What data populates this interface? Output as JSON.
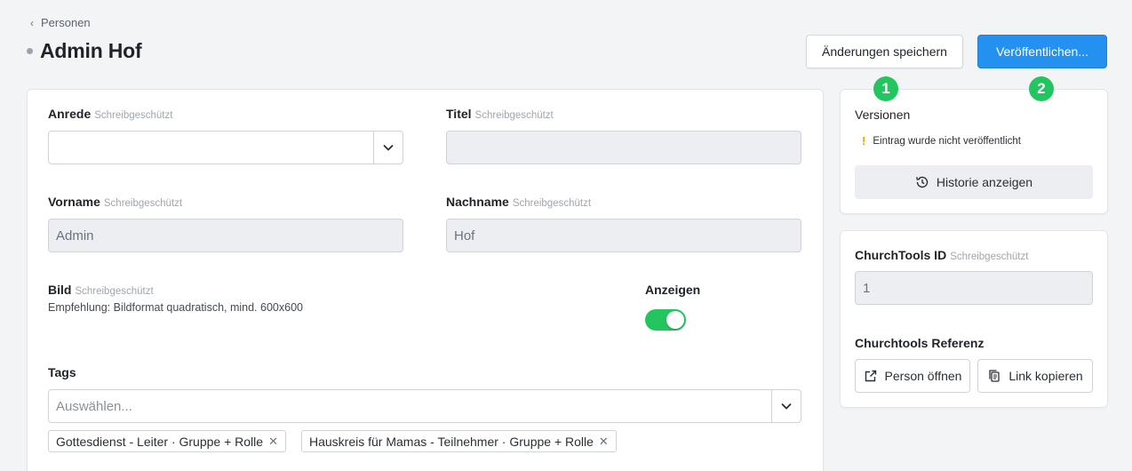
{
  "breadcrumb": {
    "label": "Personen",
    "icon": "chevron-left-icon"
  },
  "page": {
    "title": "Admin Hof",
    "status_color": "#9ca3af"
  },
  "header_actions": {
    "save_label": "Änderungen speichern",
    "publish_label": "Veröffentlichen..."
  },
  "markers": [
    "1",
    "2"
  ],
  "form": {
    "readonly_hint": "Schreibgeschützt",
    "anrede": {
      "label": "Anrede",
      "value": ""
    },
    "titel": {
      "label": "Titel",
      "value": ""
    },
    "vorname": {
      "label": "Vorname",
      "value": "Admin"
    },
    "nachname": {
      "label": "Nachname",
      "value": "Hof"
    },
    "bild": {
      "label": "Bild",
      "hint": "Empfehlung: Bildformat quadratisch, mind. 600x600"
    },
    "anzeigen": {
      "label": "Anzeigen",
      "enabled": true
    },
    "tags": {
      "label": "Tags",
      "placeholder": "Auswählen...",
      "selected": [
        "Gottesdienst - Leiter · Gruppe + Rolle",
        "Hauskreis für Mamas - Teilnehmer · Gruppe + Rolle"
      ]
    }
  },
  "versions": {
    "title": "Versionen",
    "warning": "Eintrag wurde nicht veröffentlicht",
    "history_button": "Historie anzeigen"
  },
  "churchtools": {
    "id_label": "ChurchTools ID",
    "id_value": "1",
    "reference_label": "Churchtools Referenz",
    "open_person_button": "Person öffnen",
    "copy_link_button": "Link kopieren"
  },
  "colors": {
    "accent": "#2490ef",
    "toggle_on": "#22c55e",
    "marker": "#22c55e",
    "warning": "#f59e0b"
  }
}
